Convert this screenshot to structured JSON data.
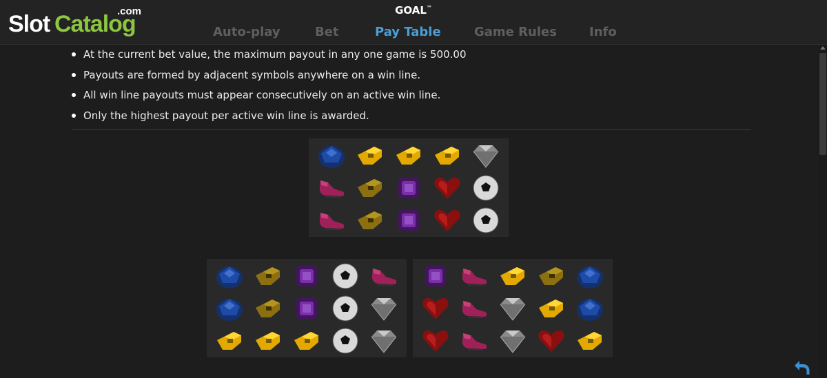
{
  "logo": {
    "slot": "Slot",
    "catalog": "Catalog",
    "com": ".com"
  },
  "game": {
    "title": "GOAL",
    "trademark": "™"
  },
  "tabs": [
    {
      "label": "Auto-play",
      "active": false
    },
    {
      "label": "Bet",
      "active": false
    },
    {
      "label": "Pay Table",
      "active": true
    },
    {
      "label": "Game Rules",
      "active": false
    },
    {
      "label": "Info",
      "active": false
    }
  ],
  "rules": [
    "At the current bet value, the maximum payout in any one game is 500.00",
    "Payouts are formed by adjacent symbols anywhere on a win line.",
    "All win line payouts must appear consecutively on an active win line.",
    "Only the highest payout per active win line is awarded."
  ],
  "examples": [
    {
      "rows": [
        [
          "sapphire-icon",
          "whistle-gold-icon",
          "whistle-gold-icon",
          "whistle-gold-icon",
          "diamond-icon"
        ],
        [
          "boot-icon",
          "whistle-dark-icon",
          "amethyst-icon",
          "ruby-heart-icon",
          "football-icon"
        ],
        [
          "boot-icon",
          "whistle-dark-icon",
          "amethyst-icon",
          "ruby-heart-icon",
          "football-icon"
        ]
      ]
    },
    {
      "rows": [
        [
          "sapphire-icon",
          "whistle-dark-icon",
          "amethyst-icon",
          "football-icon",
          "boot-icon"
        ],
        [
          "sapphire-icon",
          "whistle-dark-icon",
          "amethyst-icon",
          "football-icon",
          "diamond-icon"
        ],
        [
          "whistle-gold-icon",
          "whistle-gold-icon",
          "whistle-gold-icon",
          "football-icon",
          "diamond-icon"
        ]
      ]
    },
    {
      "rows": [
        [
          "amethyst-icon",
          "boot-icon",
          "whistle-gold-icon",
          "whistle-dark-icon",
          "sapphire-icon"
        ],
        [
          "ruby-heart-icon",
          "boot-icon",
          "diamond-icon",
          "whistle-gold-icon",
          "sapphire-icon"
        ],
        [
          "ruby-heart-icon",
          "boot-icon",
          "diamond-icon",
          "ruby-heart-icon",
          "whistle-gold-icon"
        ]
      ]
    }
  ],
  "colors": {
    "background": "#1d1d1d",
    "active_tab": "#4a9fd6",
    "inactive_tab": "#5f5f5f",
    "logo_green": "#8cc63f",
    "back_arrow": "#3d8fd1"
  }
}
